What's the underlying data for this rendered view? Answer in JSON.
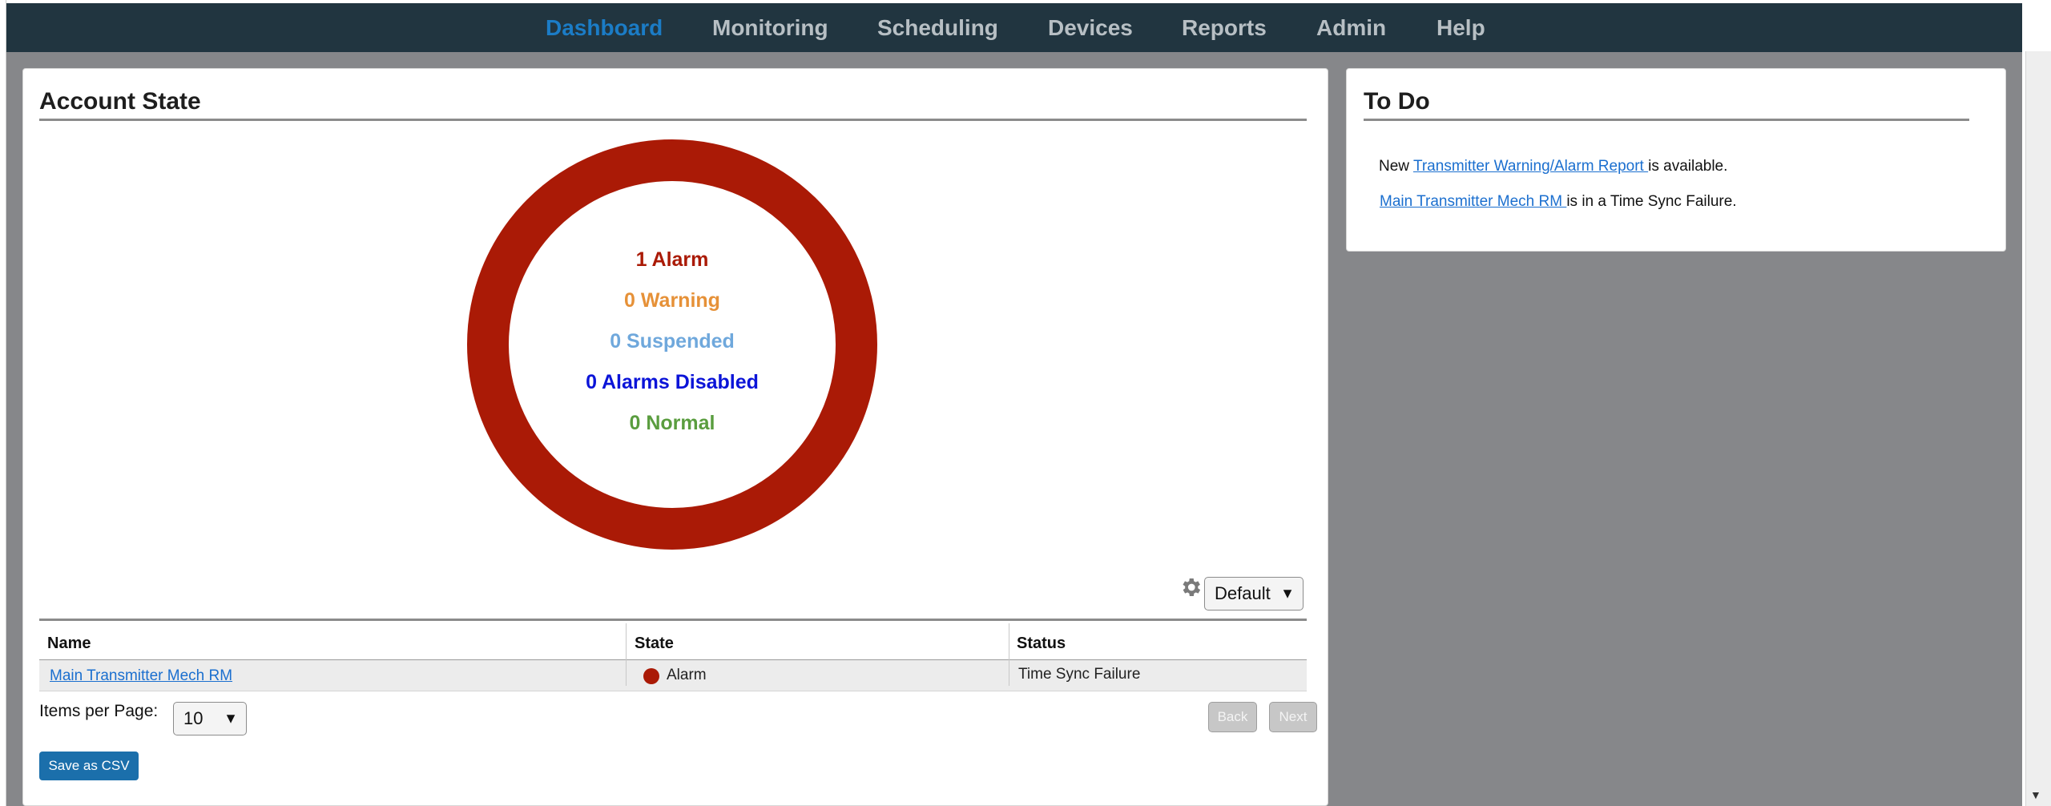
{
  "nav": {
    "items": [
      {
        "label": "Dashboard",
        "active": true
      },
      {
        "label": "Monitoring",
        "active": false
      },
      {
        "label": "Scheduling",
        "active": false
      },
      {
        "label": "Devices",
        "active": false
      },
      {
        "label": "Reports",
        "active": false
      },
      {
        "label": "Admin",
        "active": false
      },
      {
        "label": "Help",
        "active": false
      }
    ]
  },
  "account_state": {
    "title": "Account State",
    "summary": {
      "alarm": "1 Alarm",
      "warning": "0 Warning",
      "suspended": "0 Suspended",
      "alarms_disabled": "0 Alarms Disabled",
      "normal": "0 Normal"
    },
    "donut": {
      "segments": [
        {
          "name": "Alarm",
          "value": 1,
          "color": "#aa1a06"
        },
        {
          "name": "Warning",
          "value": 0,
          "color": "#e69138"
        },
        {
          "name": "Suspended",
          "value": 0,
          "color": "#6fa8dc"
        },
        {
          "name": "Alarms Disabled",
          "value": 0,
          "color": "#0b14d8"
        },
        {
          "name": "Normal",
          "value": 0,
          "color": "#5a9d3f"
        }
      ]
    },
    "view_select": {
      "value": "Default"
    },
    "table": {
      "columns": [
        "Name",
        "State",
        "Status"
      ],
      "rows": [
        {
          "name": "Main Transmitter Mech RM",
          "state": "Alarm",
          "status": "Time Sync Failure"
        }
      ]
    },
    "items_per_page_label": "Items per Page:",
    "items_per_page": "10",
    "back_label": "Back",
    "next_label": "Next",
    "save_csv_label": "Save as CSV"
  },
  "todo": {
    "title": "To Do",
    "line1_prefix": "New ",
    "line1_link": "Transmitter Warning/Alarm Report ",
    "line1_suffix": "is available.",
    "line2_link": "Main Transmitter Mech RM ",
    "line2_suffix": "is in a Time Sync Failure."
  },
  "colors": {
    "nav_bg": "#213540",
    "nav_active": "#1b7cc6",
    "nav_inactive": "#b7bfc4",
    "page_bg": "#86878a",
    "alarm": "#aa1a06",
    "warning": "#e69138",
    "suspended": "#6fa8dc",
    "alarms_disabled": "#0b14d8",
    "normal": "#5a9d3f",
    "link": "#1b6fcf",
    "primary_button": "#1b6fab"
  }
}
